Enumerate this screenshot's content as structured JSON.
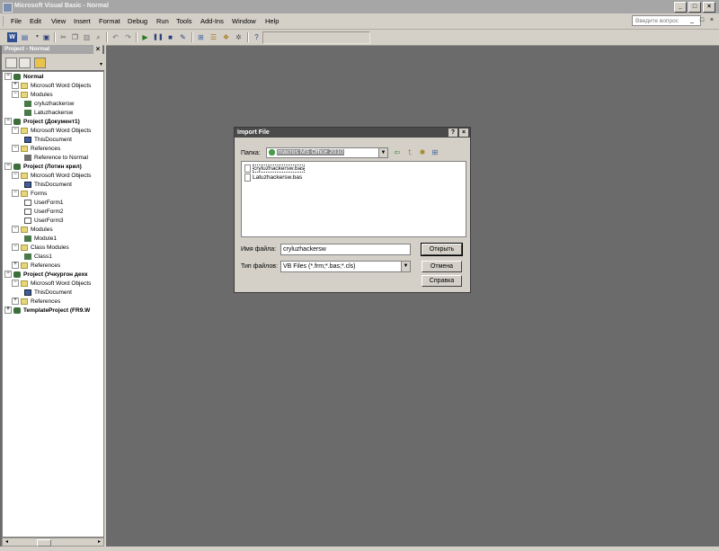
{
  "window": {
    "title": "Microsoft Visual Basic - Normal",
    "controls": [
      "_",
      "□",
      "×"
    ]
  },
  "menubar": {
    "items": [
      "File",
      "Edit",
      "View",
      "Insert",
      "Format",
      "Debug",
      "Run",
      "Tools",
      "Add-Ins",
      "Window",
      "Help"
    ],
    "help_placeholder": "Введите вопрос",
    "mdi_controls": [
      "_",
      "□",
      "×"
    ]
  },
  "toolbar": {
    "icons": [
      "view-word-icon",
      "insert-module-icon",
      "save-icon",
      "cut-icon",
      "copy-icon",
      "paste-icon",
      "find-icon",
      "undo-icon",
      "redo-icon",
      "run-icon",
      "break-icon",
      "reset-icon",
      "design-mode-icon",
      "project-explorer-icon",
      "properties-icon",
      "object-browser-icon",
      "toolbox-icon",
      "help-icon"
    ]
  },
  "project_panel": {
    "title": "Project - Normal",
    "close": "×",
    "tree": [
      {
        "label": "Normal",
        "level": 0,
        "expander": "−",
        "icon": "proj",
        "bold": true
      },
      {
        "label": "Microsoft Word Objects",
        "level": 1,
        "expander": "+",
        "icon": "folder"
      },
      {
        "label": "Modules",
        "level": 1,
        "expander": "−",
        "icon": "folder"
      },
      {
        "label": "cryluzhackersw",
        "level": 2,
        "icon": "mod"
      },
      {
        "label": "Latuzhackersw",
        "level": 2,
        "icon": "mod"
      },
      {
        "label": "Project (Документ1)",
        "level": 0,
        "expander": "−",
        "icon": "proj",
        "bold": true
      },
      {
        "label": "Microsoft Word Objects",
        "level": 1,
        "expander": "−",
        "icon": "folder"
      },
      {
        "label": "ThisDocument",
        "level": 2,
        "icon": "doc"
      },
      {
        "label": "References",
        "level": 1,
        "expander": "−",
        "icon": "folder"
      },
      {
        "label": "Reference to Normal",
        "level": 2,
        "icon": "ref"
      },
      {
        "label": "Project (Лотин крил)",
        "level": 0,
        "expander": "−",
        "icon": "proj",
        "bold": true
      },
      {
        "label": "Microsoft Word Objects",
        "level": 1,
        "expander": "−",
        "icon": "folder"
      },
      {
        "label": "ThisDocument",
        "level": 2,
        "icon": "doc"
      },
      {
        "label": "Forms",
        "level": 1,
        "expander": "−",
        "icon": "folder"
      },
      {
        "label": "UserForm1",
        "level": 2,
        "icon": "form"
      },
      {
        "label": "UserForm2",
        "level": 2,
        "icon": "form"
      },
      {
        "label": "UserForm3",
        "level": 2,
        "icon": "form"
      },
      {
        "label": "Modules",
        "level": 1,
        "expander": "−",
        "icon": "folder"
      },
      {
        "label": "Module1",
        "level": 2,
        "icon": "mod"
      },
      {
        "label": "Class Modules",
        "level": 1,
        "expander": "−",
        "icon": "folder"
      },
      {
        "label": "Class1",
        "level": 2,
        "icon": "mod"
      },
      {
        "label": "References",
        "level": 1,
        "expander": "+",
        "icon": "folder"
      },
      {
        "label": "Project (Учкургон дехк",
        "level": 0,
        "expander": "−",
        "icon": "proj",
        "bold": true
      },
      {
        "label": "Microsoft Word Objects",
        "level": 1,
        "expander": "−",
        "icon": "folder"
      },
      {
        "label": "ThisDocument",
        "level": 2,
        "icon": "doc"
      },
      {
        "label": "References",
        "level": 1,
        "expander": "+",
        "icon": "folder"
      },
      {
        "label": "TemplateProject (FR9.W",
        "level": 0,
        "expander": "+",
        "icon": "proj",
        "bold": true
      }
    ]
  },
  "dialog": {
    "title": "Import File",
    "title_buttons": [
      "?",
      "×"
    ],
    "folder_label": "Папка:",
    "folder_value": "macros MS Office 2010",
    "files": [
      {
        "name": "cryluzhackersw.bas",
        "selected": true
      },
      {
        "name": "Latuzhackersw.bas",
        "selected": false
      }
    ],
    "filename_label": "Имя файла:",
    "filename_value": "cryluzhackersw",
    "filetype_label": "Тип файлов:",
    "filetype_value": "VB Files (*.frm;*.bas;*.cls)",
    "open_button": "Открыть",
    "cancel_button": "Отмена",
    "help_button": "Справка"
  }
}
